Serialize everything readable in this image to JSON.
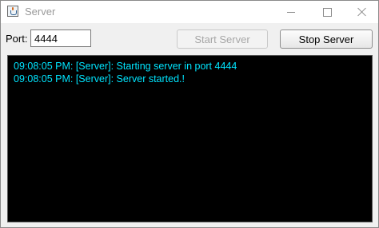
{
  "window": {
    "title": "Server",
    "app_icon": "java-cup-icon",
    "controls": {
      "minimize_icon": "minimize-icon",
      "maximize_icon": "maximize-icon",
      "close_icon": "close-icon"
    }
  },
  "toolbar": {
    "port_label": "Port:",
    "port_value": "4444",
    "start_label": "Start Server",
    "start_enabled": false,
    "stop_label": "Stop Server",
    "stop_enabled": true
  },
  "console": {
    "background": "#000000",
    "text_color": "#00e5ff",
    "lines": [
      "09:08:05 PM: [Server]: Starting server in port 4444",
      "09:08:05 PM: [Server]: Server started.!"
    ]
  }
}
